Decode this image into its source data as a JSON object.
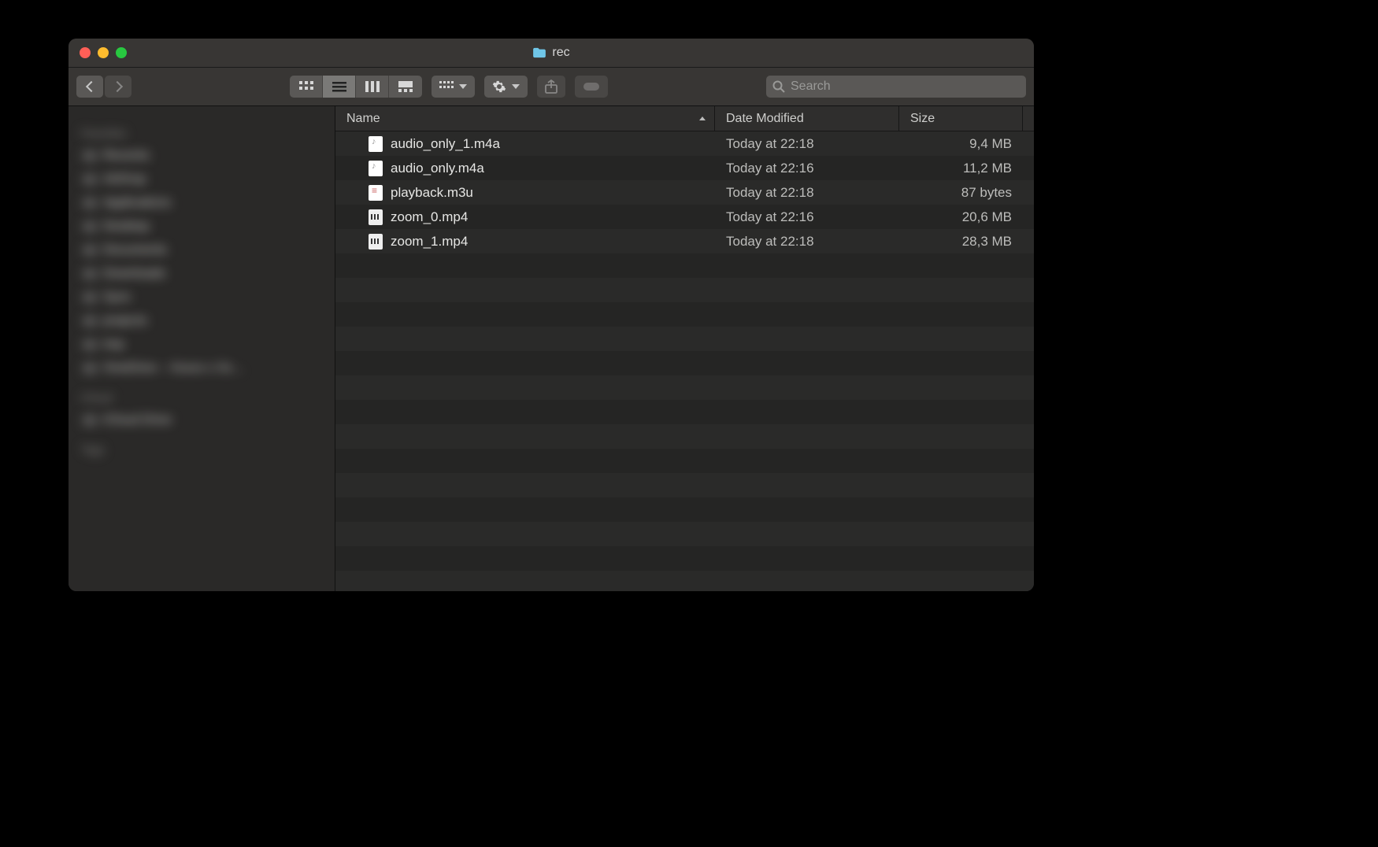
{
  "window": {
    "title": "rec"
  },
  "toolbar": {
    "search_placeholder": "Search"
  },
  "columns": {
    "name": "Name",
    "date": "Date Modified",
    "size": "Size"
  },
  "sidebar": {
    "sections": [
      {
        "label": "Favorites",
        "items": [
          "Recents",
          "AirDrop",
          "Applications",
          "Desktop",
          "Documents",
          "Downloads",
          "Sync",
          "projects",
          "tmp",
          "OneDrive – Xxxxx x Xx…"
        ]
      },
      {
        "label": "iCloud",
        "items": [
          "iCloud Drive"
        ]
      },
      {
        "label": "Tags",
        "items": []
      }
    ]
  },
  "files": [
    {
      "name": "audio_only_1.m4a",
      "date": "Today at 22:18",
      "size": "9,4 MB",
      "icon": "audio"
    },
    {
      "name": "audio_only.m4a",
      "date": "Today at 22:16",
      "size": "11,2 MB",
      "icon": "audio"
    },
    {
      "name": "playback.m3u",
      "date": "Today at 22:18",
      "size": "87 bytes",
      "icon": "playlist"
    },
    {
      "name": "zoom_0.mp4",
      "date": "Today at 22:16",
      "size": "20,6 MB",
      "icon": "video"
    },
    {
      "name": "zoom_1.mp4",
      "date": "Today at 22:18",
      "size": "28,3 MB",
      "icon": "video"
    }
  ]
}
